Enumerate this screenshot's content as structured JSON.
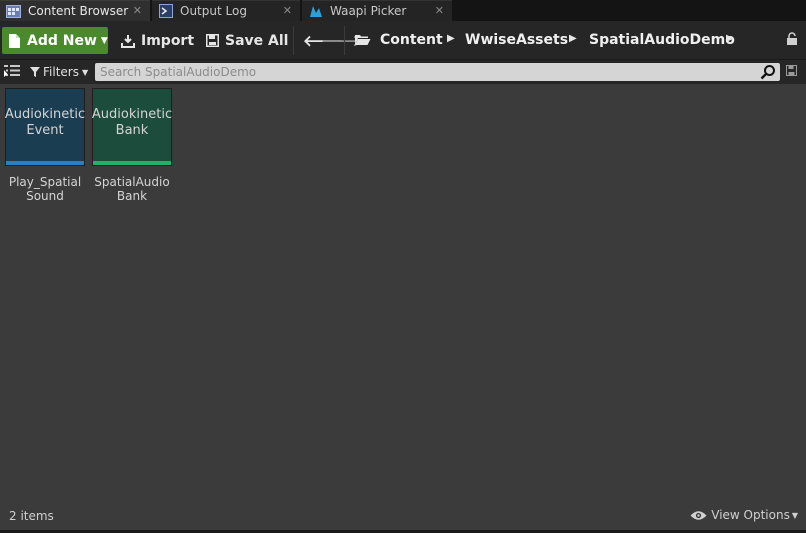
{
  "tabs": [
    {
      "label": "Content Browser",
      "icon": "content-browser-icon",
      "active": true
    },
    {
      "label": "Output Log",
      "icon": "output-log-icon",
      "active": false
    },
    {
      "label": "Waapi Picker",
      "icon": "waapi-icon",
      "active": false
    }
  ],
  "toolbar": {
    "add_new_label": "Add New",
    "import_label": "Import",
    "save_all_label": "Save All"
  },
  "breadcrumb": [
    "Content",
    "WwiseAssets",
    "SpatialAudioDemo"
  ],
  "filter": {
    "filters_label": "Filters",
    "search_placeholder": "Search SpatialAudioDemo"
  },
  "assets": [
    {
      "type_label": "Audiokinetic Event",
      "name": "Play_Spatial Sound",
      "color": "#1b3d52",
      "stripe": "#2a7fc4"
    },
    {
      "type_label": "Audiokinetic Bank",
      "name": "SpatialAudio Bank",
      "color": "#1b4c3c",
      "stripe": "#23b26a"
    }
  ],
  "status": {
    "item_count": "2 items",
    "view_options_label": "View Options"
  },
  "colors": {
    "add_new_green": "#4a8a2c",
    "panel_bg": "#3b3b3b",
    "toolbar_bg": "#262626"
  }
}
